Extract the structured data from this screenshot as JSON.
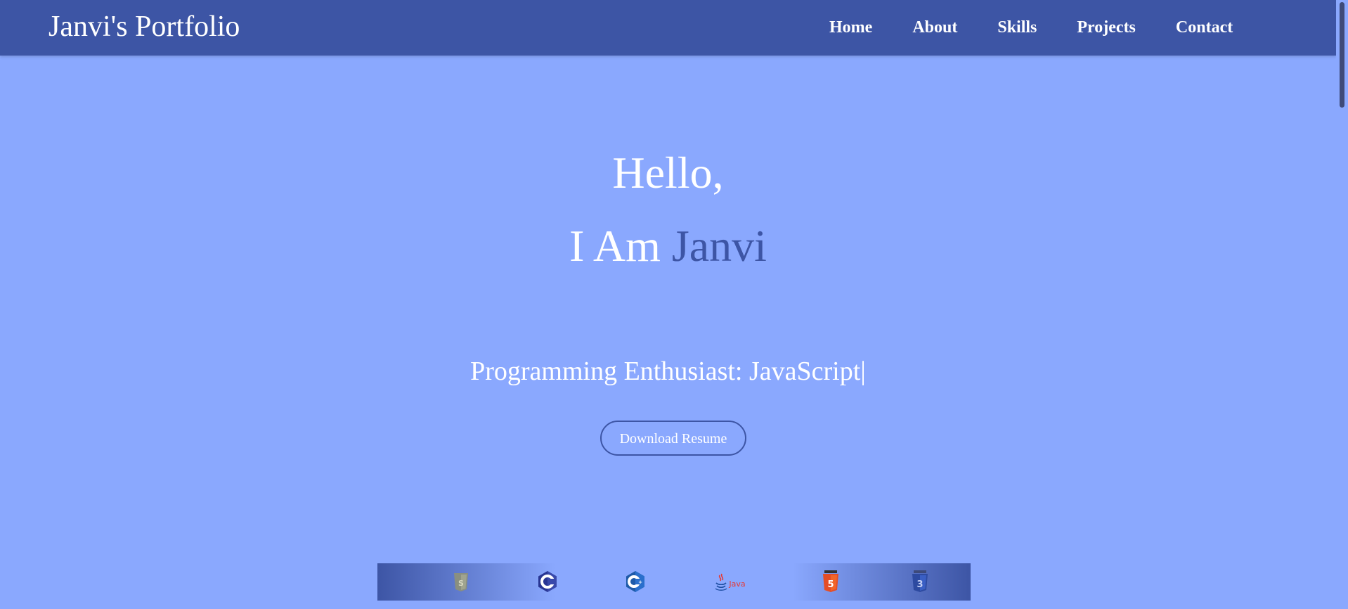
{
  "brand": "Janvi's Portfolio",
  "nav": [
    {
      "label": "Home"
    },
    {
      "label": "About"
    },
    {
      "label": "Skills"
    },
    {
      "label": "Projects"
    },
    {
      "label": "Contact"
    }
  ],
  "hero": {
    "greeting": "Hello,",
    "intro_prefix": "I Am",
    "name": "Janvi",
    "tagline": "Programming Enthusiast: JavaScript",
    "cursor": "|",
    "resume_button": "Download Resume"
  },
  "skills": [
    {
      "icon": "js-icon",
      "label": ""
    },
    {
      "icon": "c-icon",
      "label": ""
    },
    {
      "icon": "cpp-icon",
      "label": ""
    },
    {
      "icon": "java-icon",
      "label": "Java"
    },
    {
      "icon": "html5-icon",
      "label": "5"
    },
    {
      "icon": "css3-icon",
      "label": "3"
    }
  ],
  "colors": {
    "background": "#8aa8fe",
    "navbar": "#3d55a5",
    "accent": "#3d55a5",
    "text": "#ffffff"
  }
}
